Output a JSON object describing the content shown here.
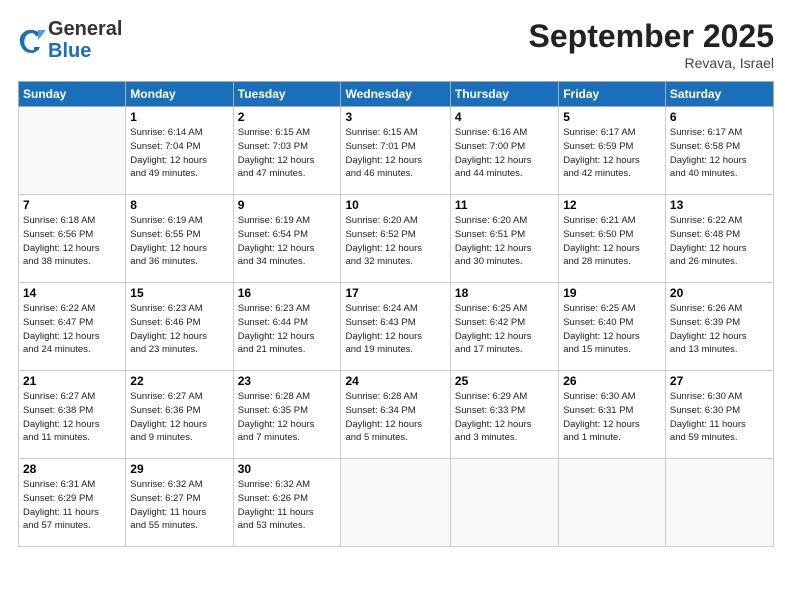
{
  "header": {
    "logo_line1": "General",
    "logo_line2": "Blue",
    "month": "September 2025",
    "location": "Revava, Israel"
  },
  "weekdays": [
    "Sunday",
    "Monday",
    "Tuesday",
    "Wednesday",
    "Thursday",
    "Friday",
    "Saturday"
  ],
  "weeks": [
    [
      {
        "day": "",
        "info": ""
      },
      {
        "day": "1",
        "info": "Sunrise: 6:14 AM\nSunset: 7:04 PM\nDaylight: 12 hours\nand 49 minutes."
      },
      {
        "day": "2",
        "info": "Sunrise: 6:15 AM\nSunset: 7:03 PM\nDaylight: 12 hours\nand 47 minutes."
      },
      {
        "day": "3",
        "info": "Sunrise: 6:15 AM\nSunset: 7:01 PM\nDaylight: 12 hours\nand 46 minutes."
      },
      {
        "day": "4",
        "info": "Sunrise: 6:16 AM\nSunset: 7:00 PM\nDaylight: 12 hours\nand 44 minutes."
      },
      {
        "day": "5",
        "info": "Sunrise: 6:17 AM\nSunset: 6:59 PM\nDaylight: 12 hours\nand 42 minutes."
      },
      {
        "day": "6",
        "info": "Sunrise: 6:17 AM\nSunset: 6:58 PM\nDaylight: 12 hours\nand 40 minutes."
      }
    ],
    [
      {
        "day": "7",
        "info": "Sunrise: 6:18 AM\nSunset: 6:56 PM\nDaylight: 12 hours\nand 38 minutes."
      },
      {
        "day": "8",
        "info": "Sunrise: 6:19 AM\nSunset: 6:55 PM\nDaylight: 12 hours\nand 36 minutes."
      },
      {
        "day": "9",
        "info": "Sunrise: 6:19 AM\nSunset: 6:54 PM\nDaylight: 12 hours\nand 34 minutes."
      },
      {
        "day": "10",
        "info": "Sunrise: 6:20 AM\nSunset: 6:52 PM\nDaylight: 12 hours\nand 32 minutes."
      },
      {
        "day": "11",
        "info": "Sunrise: 6:20 AM\nSunset: 6:51 PM\nDaylight: 12 hours\nand 30 minutes."
      },
      {
        "day": "12",
        "info": "Sunrise: 6:21 AM\nSunset: 6:50 PM\nDaylight: 12 hours\nand 28 minutes."
      },
      {
        "day": "13",
        "info": "Sunrise: 6:22 AM\nSunset: 6:48 PM\nDaylight: 12 hours\nand 26 minutes."
      }
    ],
    [
      {
        "day": "14",
        "info": "Sunrise: 6:22 AM\nSunset: 6:47 PM\nDaylight: 12 hours\nand 24 minutes."
      },
      {
        "day": "15",
        "info": "Sunrise: 6:23 AM\nSunset: 6:46 PM\nDaylight: 12 hours\nand 23 minutes."
      },
      {
        "day": "16",
        "info": "Sunrise: 6:23 AM\nSunset: 6:44 PM\nDaylight: 12 hours\nand 21 minutes."
      },
      {
        "day": "17",
        "info": "Sunrise: 6:24 AM\nSunset: 6:43 PM\nDaylight: 12 hours\nand 19 minutes."
      },
      {
        "day": "18",
        "info": "Sunrise: 6:25 AM\nSunset: 6:42 PM\nDaylight: 12 hours\nand 17 minutes."
      },
      {
        "day": "19",
        "info": "Sunrise: 6:25 AM\nSunset: 6:40 PM\nDaylight: 12 hours\nand 15 minutes."
      },
      {
        "day": "20",
        "info": "Sunrise: 6:26 AM\nSunset: 6:39 PM\nDaylight: 12 hours\nand 13 minutes."
      }
    ],
    [
      {
        "day": "21",
        "info": "Sunrise: 6:27 AM\nSunset: 6:38 PM\nDaylight: 12 hours\nand 11 minutes."
      },
      {
        "day": "22",
        "info": "Sunrise: 6:27 AM\nSunset: 6:36 PM\nDaylight: 12 hours\nand 9 minutes."
      },
      {
        "day": "23",
        "info": "Sunrise: 6:28 AM\nSunset: 6:35 PM\nDaylight: 12 hours\nand 7 minutes."
      },
      {
        "day": "24",
        "info": "Sunrise: 6:28 AM\nSunset: 6:34 PM\nDaylight: 12 hours\nand 5 minutes."
      },
      {
        "day": "25",
        "info": "Sunrise: 6:29 AM\nSunset: 6:33 PM\nDaylight: 12 hours\nand 3 minutes."
      },
      {
        "day": "26",
        "info": "Sunrise: 6:30 AM\nSunset: 6:31 PM\nDaylight: 12 hours\nand 1 minute."
      },
      {
        "day": "27",
        "info": "Sunrise: 6:30 AM\nSunset: 6:30 PM\nDaylight: 11 hours\nand 59 minutes."
      }
    ],
    [
      {
        "day": "28",
        "info": "Sunrise: 6:31 AM\nSunset: 6:29 PM\nDaylight: 11 hours\nand 57 minutes."
      },
      {
        "day": "29",
        "info": "Sunrise: 6:32 AM\nSunset: 6:27 PM\nDaylight: 11 hours\nand 55 minutes."
      },
      {
        "day": "30",
        "info": "Sunrise: 6:32 AM\nSunset: 6:26 PM\nDaylight: 11 hours\nand 53 minutes."
      },
      {
        "day": "",
        "info": ""
      },
      {
        "day": "",
        "info": ""
      },
      {
        "day": "",
        "info": ""
      },
      {
        "day": "",
        "info": ""
      }
    ]
  ]
}
